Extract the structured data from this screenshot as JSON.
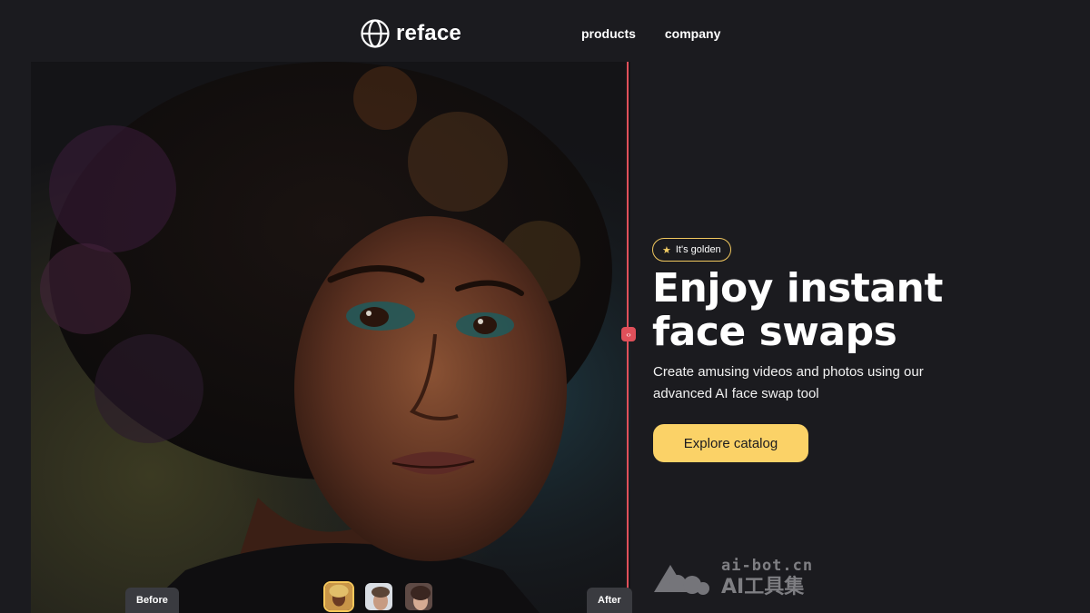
{
  "header": {
    "logo_text": "reface",
    "nav": {
      "products": "products",
      "company": "company"
    }
  },
  "hero": {
    "compare": {
      "before_label": "Before",
      "after_label": "After"
    },
    "thumbnails": [
      "thumbnail-1",
      "thumbnail-2",
      "thumbnail-3"
    ]
  },
  "content": {
    "badge": "It's golden",
    "headline_line1": "Enjoy instant",
    "headline_line2": "face swaps",
    "subtitle": "Create amusing videos and photos using our advanced AI face swap tool",
    "cta": "Explore catalog"
  },
  "watermark": {
    "line1": "ai-bot.cn",
    "line2": "AI工具集"
  },
  "colors": {
    "background": "#1b1b1f",
    "accent": "#fbd267",
    "divider": "#e0505a"
  }
}
